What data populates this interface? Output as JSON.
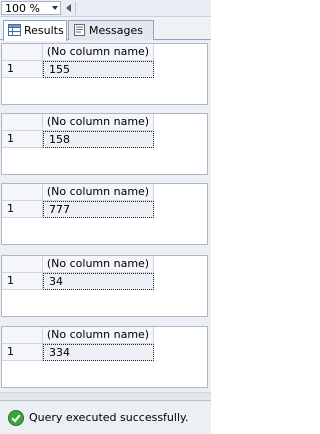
{
  "toolbar": {
    "zoom": "100 %"
  },
  "tabs": [
    {
      "label": "Results",
      "icon": "grid-icon",
      "active": true
    },
    {
      "label": "Messages",
      "icon": "messages-icon",
      "active": false
    }
  ],
  "result_sets": [
    {
      "column": "(No column name)",
      "row": "1",
      "value": "155"
    },
    {
      "column": "(No column name)",
      "row": "1",
      "value": "158"
    },
    {
      "column": "(No column name)",
      "row": "1",
      "value": "777"
    },
    {
      "column": "(No column name)",
      "row": "1",
      "value": "34"
    },
    {
      "column": "(No column name)",
      "row": "1",
      "value": "334"
    }
  ],
  "status": {
    "message": "Query executed successfully.",
    "icon": "check-circle-icon",
    "color": "#2e9b2e"
  }
}
